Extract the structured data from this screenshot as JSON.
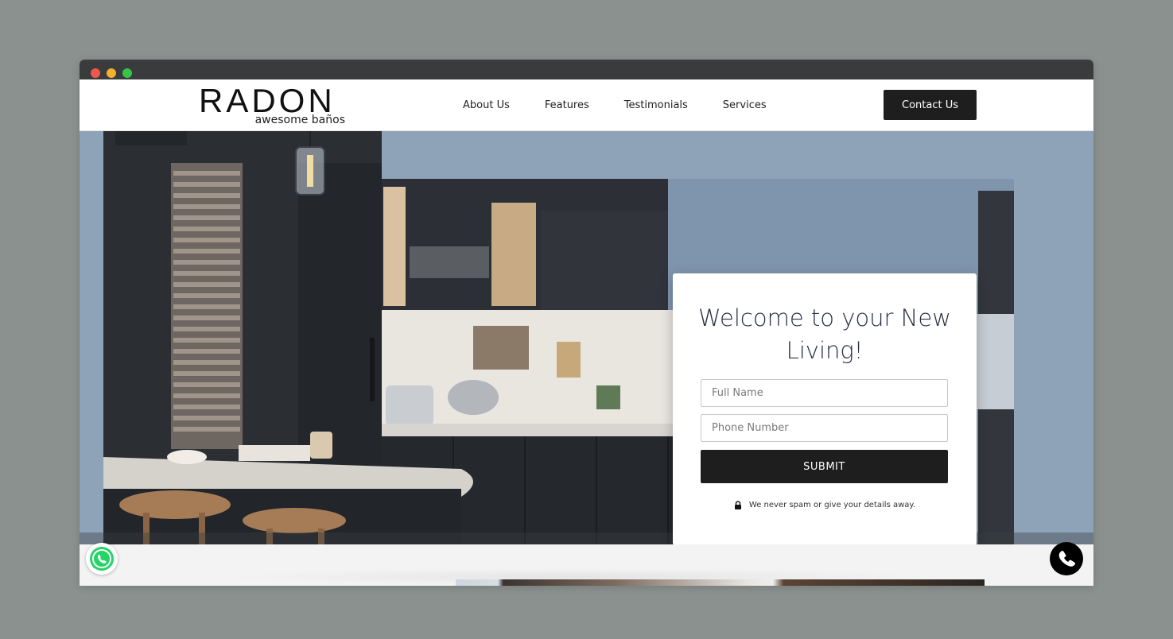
{
  "brand": {
    "name": "RADON",
    "tagline": "awesome baños"
  },
  "nav": {
    "links": [
      {
        "label": "About Us"
      },
      {
        "label": "Features"
      },
      {
        "label": "Testimonials"
      },
      {
        "label": "Services"
      }
    ],
    "contact_label": "Contact Us"
  },
  "form": {
    "title": "Welcome to your New Living!",
    "name_placeholder": "Full Name",
    "phone_placeholder": "Phone Number",
    "submit_label": "SUBMIT",
    "privacy_note": "We never spam or give your details away."
  },
  "floating": {
    "whatsapp_icon": "whatsapp-icon",
    "phone_icon": "phone-icon"
  },
  "colors": {
    "primary_dark": "#1e1e1e",
    "title_text": "#2a2d45",
    "whatsapp_green": "#25d366"
  }
}
